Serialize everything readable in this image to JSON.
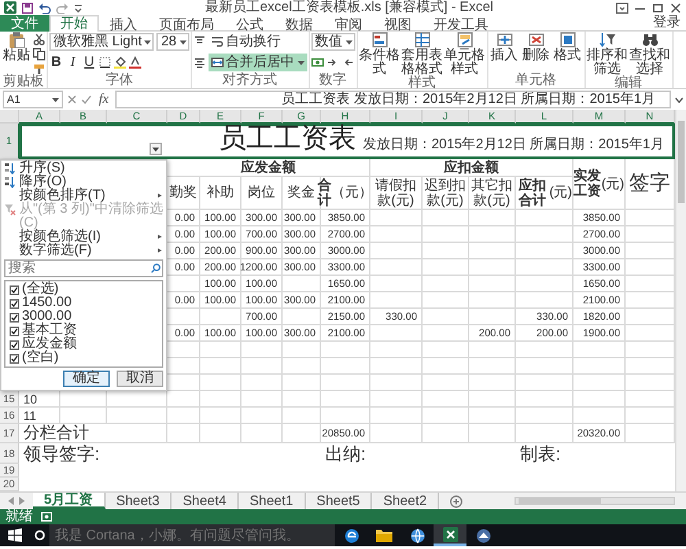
{
  "window": {
    "title": "最新员工excel工资表模板.xls [兼容模式] - Excel"
  },
  "ribbon_tabs": [
    {
      "label": "文件",
      "kind": "file",
      "selected": false
    },
    {
      "label": "开始",
      "kind": "tab",
      "selected": true
    },
    {
      "label": "插入",
      "kind": "tab",
      "selected": false
    },
    {
      "label": "页面布局",
      "kind": "tab",
      "selected": false
    },
    {
      "label": "公式",
      "kind": "tab",
      "selected": false
    },
    {
      "label": "数据",
      "kind": "tab",
      "selected": false
    },
    {
      "label": "审阅",
      "kind": "tab",
      "selected": false
    },
    {
      "label": "视图",
      "kind": "tab",
      "selected": false
    },
    {
      "label": "开发工具",
      "kind": "tab",
      "selected": false
    }
  ],
  "sign_in": "登录",
  "ribbon_groups": [
    {
      "label": "剪贴板",
      "controls": [
        {
          "kind": "large",
          "label": "粘贴"
        }
      ]
    },
    {
      "label": "字体",
      "controls": [
        {
          "kind": "combo",
          "value": "微软雅黑 Light"
        },
        {
          "kind": "combo",
          "value": "28"
        },
        {
          "kind": "glyph",
          "label": "B"
        },
        {
          "kind": "glyph",
          "label": "I"
        },
        {
          "kind": "glyph",
          "label": "U"
        }
      ]
    },
    {
      "label": "对齐方式",
      "controls": [
        {
          "kind": "toggle",
          "label": "自动换行",
          "on": false
        },
        {
          "kind": "toggle",
          "label": "合并后居中",
          "on": true
        }
      ]
    },
    {
      "label": "数字",
      "controls": [
        {
          "kind": "combo",
          "value": "数值"
        }
      ]
    },
    {
      "label": "样式",
      "controls": [
        {
          "kind": "large",
          "label": "条件格式"
        },
        {
          "kind": "large",
          "label": "套用表格格式"
        },
        {
          "kind": "large",
          "label": "单元格样式"
        }
      ]
    },
    {
      "label": "单元格",
      "controls": [
        {
          "kind": "large",
          "label": "插入"
        },
        {
          "kind": "large",
          "label": "删除"
        },
        {
          "kind": "large",
          "label": "格式"
        }
      ]
    },
    {
      "label": "编辑",
      "controls": [
        {
          "kind": "large",
          "label": "排序和筛选"
        },
        {
          "kind": "large",
          "label": "查找和选择"
        }
      ]
    }
  ],
  "formula_bar": {
    "name_box": "A1",
    "function_label": "fx",
    "content": "员工工资表 发放日期：2015年2月12日 所属日期：2015年1月"
  },
  "sheet": {
    "columns": [
      "A",
      "B",
      "C",
      "D",
      "E",
      "F",
      "G",
      "H",
      "I",
      "J",
      "K",
      "L",
      "M",
      "N"
    ],
    "title_row": {
      "number": "1",
      "title": "员工工资表",
      "subtitle": "发放日期：2015年2月12日 所属日期：2015年1月"
    },
    "group_headers": [
      "应发金额",
      "应扣金额"
    ],
    "headers": [
      "勤奖",
      "补助",
      "岗位",
      "奖金",
      "**合计**（元）",
      "请假扣款(元)",
      "迟到扣款(元)",
      "其它扣款(元)",
      "**应扣合计**(元)",
      "**实发工资**(元)",
      "签字"
    ],
    "rows": [
      {
        "cells": {
          "D": "0.00",
          "E": "100.00",
          "F": "300.00",
          "G": "300.00",
          "H": "3850.00",
          "M": "3850.00"
        }
      },
      {
        "cells": {
          "D": "0.00",
          "E": "100.00",
          "F": "700.00",
          "G": "300.00",
          "H": "2700.00",
          "M": "2700.00"
        }
      },
      {
        "cells": {
          "D": "0.00",
          "E": "200.00",
          "F": "900.00",
          "G": "300.00",
          "H": "3000.00",
          "M": "3000.00"
        }
      },
      {
        "cells": {
          "D": "0.00",
          "E": "200.00",
          "F": "1200.00",
          "G": "300.00",
          "H": "3300.00",
          "M": "3300.00"
        }
      },
      {
        "cells": {
          "E": "100.00",
          "F": "100.00",
          "H": "1650.00",
          "M": "1650.00"
        }
      },
      {
        "cells": {
          "D": "0.00",
          "E": "100.00",
          "F": "100.00",
          "G": "300.00",
          "H": "2100.00",
          "M": "2100.00"
        }
      },
      {
        "cells": {
          "F": "700.00",
          "H": "2150.00",
          "I": "330.00",
          "L": "330.00",
          "M": "1820.00"
        }
      },
      {
        "cells": {
          "D": "0.00",
          "E": "100.00",
          "F": "100.00",
          "G": "300.00",
          "H": "2100.00",
          "K": "200.00",
          "L": "200.00",
          "M": "1900.00"
        }
      },
      {
        "cells": {}
      },
      {
        "cells": {}
      },
      {
        "cells": {}
      },
      {
        "number": "15",
        "cells": {
          "A": "10"
        }
      },
      {
        "number": "16",
        "cells": {
          "A": "11"
        }
      }
    ],
    "total_row": {
      "number": "17",
      "label": "分栏合计",
      "cells": {
        "H": "20850.00",
        "M": "20320.00"
      }
    },
    "signature_row": {
      "number": "18",
      "labels": [
        "领导签字:",
        "出纳:",
        "制表:"
      ]
    },
    "extra_row_numbers": [
      "19",
      "20"
    ]
  },
  "filter_menu": {
    "items": [
      {
        "label": "升序(S)",
        "kind": "sort-ascending",
        "disabled": false,
        "submenu": false
      },
      {
        "label": "降序(O)",
        "kind": "sort-descending",
        "disabled": false,
        "submenu": false
      },
      {
        "label": "按颜色排序(T)",
        "kind": "plain",
        "disabled": false,
        "submenu": true
      },
      {
        "label": "从\"(第 3 列)\"中清除筛选(C)",
        "kind": "clear-filter",
        "disabled": true,
        "submenu": false
      },
      {
        "label": "按颜色筛选(I)",
        "kind": "plain",
        "disabled": false,
        "submenu": true
      },
      {
        "label": "数字筛选(F)",
        "kind": "plain",
        "disabled": false,
        "submenu": true
      }
    ],
    "search_placeholder": "搜索",
    "options": [
      {
        "label": "(全选)",
        "checked": true
      },
      {
        "label": "1450.00",
        "checked": true
      },
      {
        "label": "3000.00",
        "checked": true
      },
      {
        "label": "基本工资",
        "checked": true
      },
      {
        "label": "应发金额",
        "checked": true
      },
      {
        "label": "(空白)",
        "checked": true
      }
    ],
    "buttons": [
      {
        "label": "确定",
        "focused": true
      },
      {
        "label": "取消",
        "focused": false
      }
    ]
  },
  "sheet_tabs": [
    {
      "label": "5月工资",
      "selected": true
    },
    {
      "label": "Sheet3",
      "selected": false
    },
    {
      "label": "Sheet4",
      "selected": false
    },
    {
      "label": "Sheet1",
      "selected": false
    },
    {
      "label": "Sheet5",
      "selected": false
    },
    {
      "label": "Sheet2",
      "selected": false
    }
  ],
  "status_bar": {
    "text": "就绪"
  },
  "taskbar": {
    "search_placeholder": "我是 Cortana，小娜。有问题尽管问我。"
  }
}
